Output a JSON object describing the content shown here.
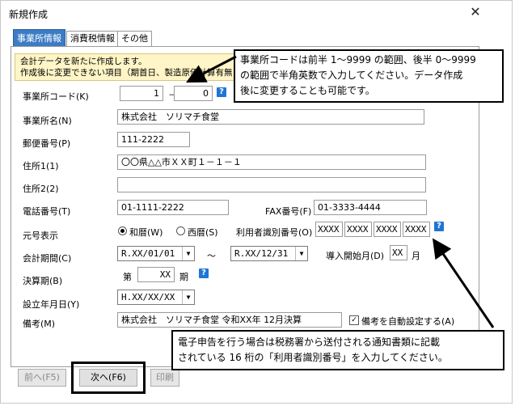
{
  "window": {
    "title": "新規作成",
    "close": "✕"
  },
  "tabs": [
    {
      "label": "事業所情報",
      "active": true
    },
    {
      "label": "消費税情報",
      "active": false
    },
    {
      "label": "その他",
      "active": false
    }
  ],
  "notice": {
    "line1": "会計データを新たに作成します。",
    "line2": "作成後に変更できない項目（期首日、製造原価計算有無"
  },
  "form": {
    "office_code": {
      "label": "事業所コード(K)",
      "front": "1",
      "sep": "－",
      "back": "0"
    },
    "office_name": {
      "label": "事業所名(N)",
      "value": "株式会社　ソリマチ食堂"
    },
    "postal": {
      "label": "郵便番号(P)",
      "value": "111-2222"
    },
    "address1": {
      "label": "住所1(1)",
      "value": "〇〇県△△市ＸＸ町１－１－１"
    },
    "address2": {
      "label": "住所2(2)",
      "value": ""
    },
    "phone": {
      "label": "電話番号(T)",
      "value": "01-1111-2222"
    },
    "fax": {
      "label": "FAX番号(F)",
      "value": "01-3333-4444"
    },
    "era": {
      "label": "元号表示",
      "options": [
        "和暦(W)",
        "西暦(S)"
      ],
      "selected": "和暦(W)"
    },
    "user_id": {
      "label": "利用者識別番号(O)",
      "parts": [
        "XXXX",
        "XXXX",
        "XXXX",
        "XXXX"
      ]
    },
    "period": {
      "label": "会計期間(C)",
      "start": "R.XX/01/01",
      "sep": "～",
      "end": "R.XX/12/31"
    },
    "intro_month": {
      "label": "導入開始月(D)",
      "value": "XX",
      "unit": "月"
    },
    "fiscal_term": {
      "label": "決算期(B)",
      "prefix": "第",
      "value": "XX",
      "suffix": "期"
    },
    "founded": {
      "label": "設立年月日(Y)",
      "value": "H.XX/XX/XX"
    },
    "remarks": {
      "label": "備考(M)",
      "value": "株式会社　ソリマチ食堂 令和XX年 12月決算"
    },
    "auto_remarks": {
      "label": "備考を自動設定する(A)",
      "checked": true
    }
  },
  "buttons": {
    "prev": "前へ(F5)",
    "next": "次へ(F6)",
    "print": "印刷"
  },
  "callouts": {
    "top": [
      "事業所コードは前半 1～9999 の範囲、後半 0～9999",
      "の範囲で半角英数で入力してください。データ作成",
      "後に変更することも可能です。"
    ],
    "bottom": [
      "電子申告を行う場合は税務署から送付される通知書類に記載",
      "されている 16 桁の「利用者識別番号」を入力してください。"
    ]
  },
  "colors": {
    "tab_active": "#3c7cc4",
    "help_icon": "#1f75d6",
    "notice_bg": "#fff5c6"
  }
}
